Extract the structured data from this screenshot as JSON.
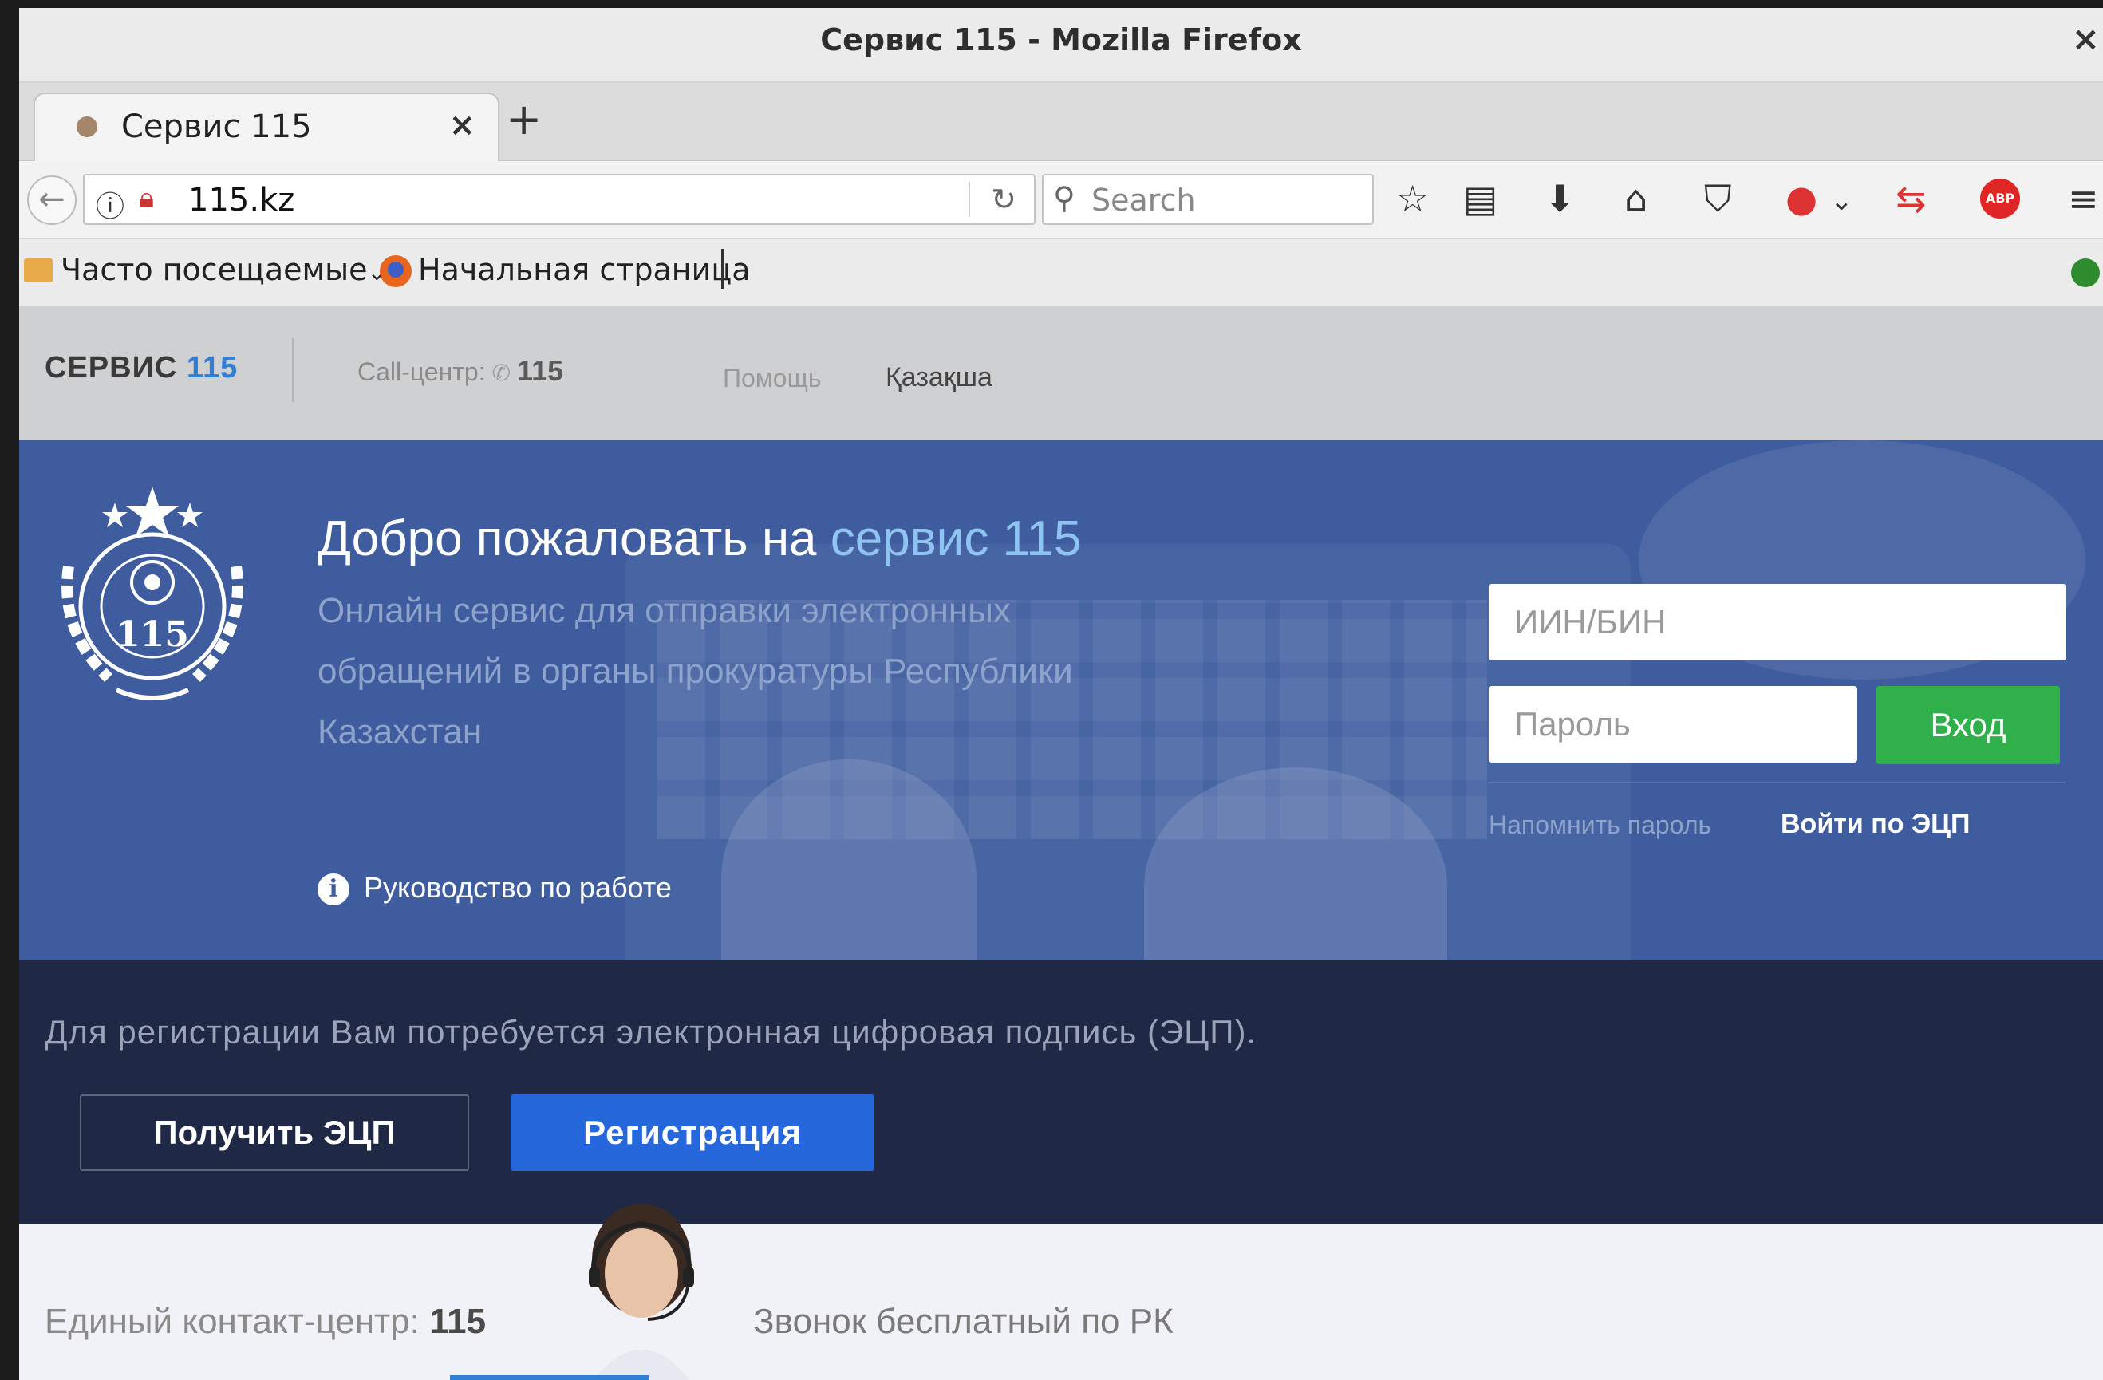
{
  "window": {
    "title": "Сервис 115 - Mozilla Firefox",
    "close_glyph": "×"
  },
  "tabs": [
    {
      "label": "Сервис 115",
      "close_glyph": "×"
    }
  ],
  "newtab_glyph": "+",
  "nav": {
    "back_glyph": "←",
    "url": "115.kz",
    "reload_glyph": "↻",
    "search_placeholder": "Search",
    "toolbar_icons": [
      "star-icon",
      "reading-list-icon",
      "download-icon",
      "home-icon",
      "pocket-icon",
      "addon-icon",
      "dropdown-icon",
      "sync-arrows-icon",
      "adblock-icon",
      "menu-icon"
    ],
    "abp_label": "ABP"
  },
  "bookmarks": [
    {
      "label": "Часто посещаемые"
    },
    {
      "label": "Начальная страница"
    }
  ],
  "site": {
    "brand": "СЕРВИС",
    "brand_num": "115",
    "callcenter_label": "Call-центр:",
    "callcenter_num": "115",
    "help": "Помощь",
    "language": "Қазақша",
    "emblem_num": "115",
    "welcome_prefix": "Добро пожаловать на",
    "welcome_accent": "сервис 115",
    "subtitle": "Онлайн сервис для отправки электронных обращений в органы прокуратуры Республики Казахстан",
    "guide": "Руководство по работе",
    "iin_placeholder": "ИИН/БИН",
    "password_placeholder": "Пароль",
    "login_button": "Вход",
    "remind_password": "Напомнить пароль",
    "ecp_login": "Войти по ЭЦП",
    "registration_note": "Для регистрации Вам потребуется электронная цифровая подпись (ЭЦП).",
    "get_ecp_button": "Получить ЭЦП",
    "register_button": "Регистрация",
    "contact_label": "Единый контакт-центр:",
    "contact_num": "115",
    "free_call": "Звонок бесплатный по РК"
  },
  "colors": {
    "hero_bg": "#3f5d9e",
    "accent_blue": "#8ec3f2",
    "login_green": "#2fb04a",
    "register_blue": "#2767dc",
    "reg_band": "#1f2844"
  }
}
